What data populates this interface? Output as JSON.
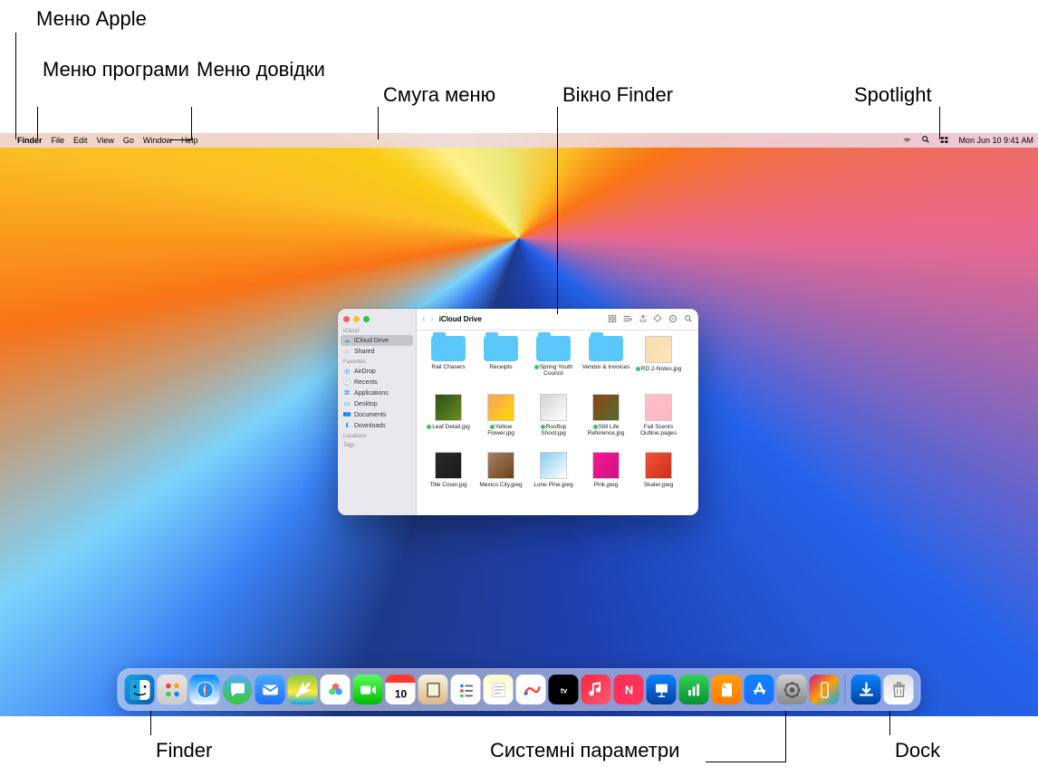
{
  "callouts": {
    "apple_menu": "Меню Apple",
    "app_menu": "Меню\nпрограми",
    "help_menu": "Меню\nдовідки",
    "menu_bar": "Смуга меню",
    "finder_window": "Вікно Finder",
    "spotlight": "Spotlight",
    "finder_label": "Finder",
    "system_settings": "Системні параметри",
    "dock": "Dock"
  },
  "menubar": {
    "items": [
      "Finder",
      "File",
      "Edit",
      "View",
      "Go",
      "Window",
      "Help"
    ],
    "datetime": "Mon Jun 10  9:41 AM"
  },
  "finder": {
    "title": "iCloud Drive",
    "sidebar": {
      "sections": [
        {
          "label": "iCloud",
          "items": [
            {
              "name": "iCloud Drive",
              "icon": "cloud-icon",
              "active": true
            },
            {
              "name": "Shared",
              "icon": "shared-icon",
              "active": false
            }
          ]
        },
        {
          "label": "Favorites",
          "items": [
            {
              "name": "AirDrop",
              "icon": "airdrop-icon"
            },
            {
              "name": "Recents",
              "icon": "clock-icon"
            },
            {
              "name": "Applications",
              "icon": "apps-icon"
            },
            {
              "name": "Desktop",
              "icon": "desktop-icon"
            },
            {
              "name": "Documents",
              "icon": "doc-icon"
            },
            {
              "name": "Downloads",
              "icon": "download-icon"
            }
          ]
        },
        {
          "label": "Locations",
          "items": []
        },
        {
          "label": "Tags",
          "items": []
        }
      ]
    },
    "files": [
      {
        "name": "Rail Chasers",
        "type": "folder"
      },
      {
        "name": "Receipts",
        "type": "folder"
      },
      {
        "name": "Spring Youth Council",
        "type": "folder",
        "sync": true
      },
      {
        "name": "Vendor & Invoices",
        "type": "folder"
      },
      {
        "name": "RD.2-Notes.jpg",
        "type": "image",
        "thumb": "t6",
        "sync": true
      },
      {
        "name": "Leaf Detail.jpg",
        "type": "image",
        "thumb": "t1",
        "sync": true
      },
      {
        "name": "Yellow Flower.jpg",
        "type": "image",
        "thumb": "t2",
        "sync": true
      },
      {
        "name": "Rooftop Shoot.jpg",
        "type": "image",
        "thumb": "t3",
        "sync": true
      },
      {
        "name": "Still Life Reference.jpg",
        "type": "image",
        "thumb": "t4",
        "sync": true
      },
      {
        "name": "Fall Scents Outline.pages",
        "type": "image",
        "thumb": "t10"
      },
      {
        "name": "Title Cover.jpg",
        "type": "image",
        "thumb": "t5"
      },
      {
        "name": "Mexico City.jpeg",
        "type": "image",
        "thumb": "t7"
      },
      {
        "name": "Lone Pine.jpeg",
        "type": "image",
        "thumb": "t8"
      },
      {
        "name": "Pink.jpeg",
        "type": "image",
        "thumb": "t9"
      },
      {
        "name": "Skater.jpeg",
        "type": "image",
        "thumb": "t11"
      }
    ]
  },
  "dock_apps": [
    "Finder",
    "Launchpad",
    "Safari",
    "Messages",
    "Mail",
    "Maps",
    "Photos",
    "FaceTime",
    "Calendar",
    "Contacts",
    "Reminders",
    "Notes",
    "Freeform",
    "TV",
    "Music",
    "News",
    "Keynote",
    "Numbers",
    "Pages",
    "App Store",
    "System Settings",
    "iPhone Mirroring"
  ],
  "dock_right": [
    "Downloads",
    "Trash"
  ],
  "calendar_day": "10"
}
